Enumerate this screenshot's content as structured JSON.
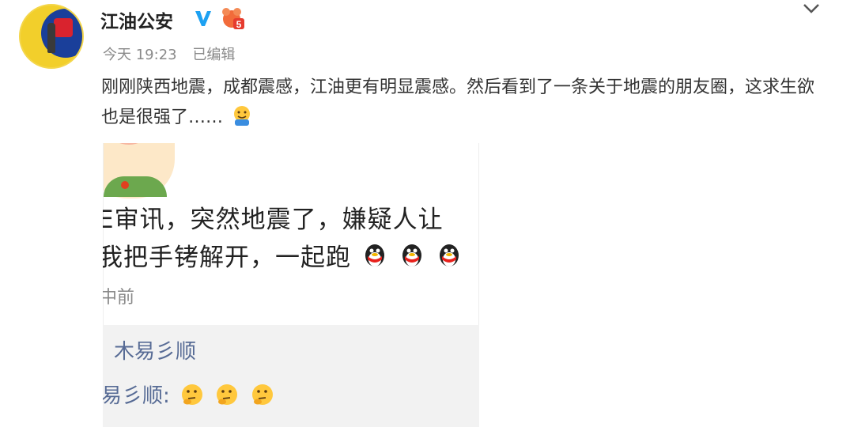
{
  "post": {
    "username": "江油公安",
    "time": "今天 19:23",
    "edited": "已编辑",
    "text": "刚刚陕西地震，成都震感，江油更有明显震感。然后看到了一条关于地震的朋友圈，这求生欲也是很强了……",
    "text_emoji": "hug-emoji",
    "verified_icon": "verified-v-icon",
    "vip_icon": "vip-badge-icon",
    "menu_icon": "chevron-down-icon"
  },
  "screenshot": {
    "line1": "E审讯，突然地震了，嫌疑人让",
    "line2": "我把手铐解开，一起跑",
    "line2_emojis": [
      "qq-penguin-emoji",
      "qq-penguin-emoji",
      "qq-penguin-emoji"
    ],
    "time": "中前",
    "comment_name": "木易彡顺",
    "comment_text": "易彡顺:",
    "comment_emojis": [
      "thinking-emoji",
      "thinking-emoji",
      "thinking-emoji"
    ]
  },
  "colors": {
    "link_blue": "#576b95",
    "verified": "#1da1f2",
    "text": "#333333"
  }
}
